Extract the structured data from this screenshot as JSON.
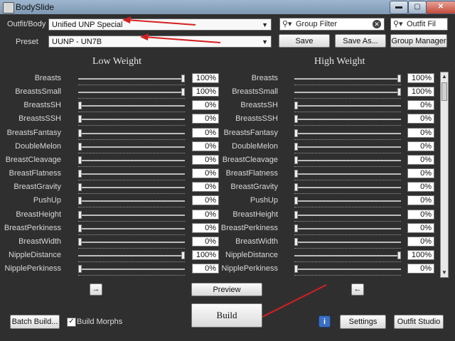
{
  "window": {
    "title": "BodySlide",
    "min_label": "▬",
    "max_label": "▢",
    "close_label": "✕"
  },
  "top": {
    "outfit_label": "Outfit/Body",
    "outfit_value": "Unified UNP Special",
    "group_filter_placeholder": "Group Filter",
    "outfit_filter_placeholder": "Outfit Fil",
    "preset_label": "Preset",
    "preset_value": "UUNP - UN7B",
    "save_label": "Save",
    "save_as_label": "Save As...",
    "group_manager_label": "Group Manager"
  },
  "headings": {
    "low": "Low Weight",
    "high": "High Weight"
  },
  "sliders": [
    {
      "name": "Breasts",
      "low": 100,
      "high": 100
    },
    {
      "name": "BreastsSmall",
      "low": 100,
      "high": 100
    },
    {
      "name": "BreastsSH",
      "low": 0,
      "high": 0
    },
    {
      "name": "BreastsSSH",
      "low": 0,
      "high": 0
    },
    {
      "name": "BreastsFantasy",
      "low": 0,
      "high": 0
    },
    {
      "name": "DoubleMelon",
      "low": 0,
      "high": 0
    },
    {
      "name": "BreastCleavage",
      "low": 0,
      "high": 0
    },
    {
      "name": "BreastFlatness",
      "low": 0,
      "high": 0
    },
    {
      "name": "BreastGravity",
      "low": 0,
      "high": 0
    },
    {
      "name": "PushUp",
      "low": 0,
      "high": 0
    },
    {
      "name": "BreastHeight",
      "low": 0,
      "high": 0
    },
    {
      "name": "BreastPerkiness",
      "low": 0,
      "high": 0
    },
    {
      "name": "BreastWidth",
      "low": 0,
      "high": 0
    },
    {
      "name": "NippleDistance",
      "low": 100,
      "high": 100
    },
    {
      "name": "NipplePerkiness",
      "low": 0,
      "high": 0
    }
  ],
  "bottom": {
    "copy_right_label": "→",
    "preview_label": "Preview",
    "copy_left_label": "←",
    "batch_build_label": "Batch Build...",
    "build_morphs_label": "Build Morphs",
    "build_morphs_checked": true,
    "build_label": "Build",
    "info_label": "i",
    "settings_label": "Settings",
    "outfit_studio_label": "Outfit Studio"
  },
  "colors": {
    "annotation_arrow": "#d42020",
    "info_button": "#3a6fc4"
  }
}
